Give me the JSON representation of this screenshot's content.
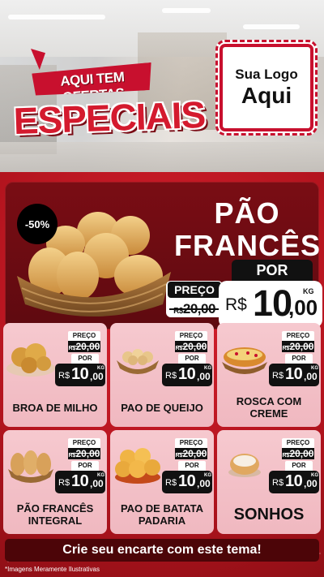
{
  "header": {
    "tag_small": "AQUI TEM OFERTAS",
    "tag_big": "ESPECIAIS",
    "logo_line1": "Sua Logo",
    "logo_line2": "Aqui"
  },
  "featured": {
    "discount": "-50%",
    "title_line1": "PÃO",
    "title_line2": "FRANCÊS",
    "preco_label": "PREÇO",
    "old_currency": "R$",
    "old_price": "20,00",
    "por_label": "POR",
    "new_currency": "R$",
    "new_int": "10",
    "new_dec": ",00",
    "unit": "KG"
  },
  "products": [
    {
      "name": "BROA DE MILHO",
      "preco_label": "PREÇO",
      "old_currency": "R$",
      "old_price": "20,00",
      "por_label": "POR",
      "new_currency": "R$",
      "new_int": "10",
      "new_dec": ",00",
      "unit": "KG",
      "image": "broa-image"
    },
    {
      "name": "PAO DE QUEIJO",
      "preco_label": "PREÇO",
      "old_currency": "R$",
      "old_price": "20,00",
      "por_label": "POR",
      "new_currency": "R$",
      "new_int": "10",
      "new_dec": ",00",
      "unit": "KG",
      "image": "pao-de-queijo-image"
    },
    {
      "name": "ROSCA COM CREME",
      "preco_label": "PREÇO",
      "old_currency": "R$",
      "old_price": "20,00",
      "por_label": "POR",
      "new_currency": "R$",
      "new_int": "10",
      "new_dec": ",00",
      "unit": "KG",
      "image": "rosca-image"
    },
    {
      "name": "PÃO FRANCÊS INTEGRAL",
      "preco_label": "PREÇO",
      "old_currency": "R$",
      "old_price": "20,00",
      "por_label": "POR",
      "new_currency": "R$",
      "new_int": "10",
      "new_dec": ",00",
      "unit": "KG",
      "image": "pao-integral-image"
    },
    {
      "name": "PAO DE BATATA PADARIA",
      "preco_label": "PREÇO",
      "old_currency": "R$",
      "old_price": "20,00",
      "por_label": "POR",
      "new_currency": "R$",
      "new_int": "10",
      "new_dec": ",00",
      "unit": "KG",
      "image": "pao-de-batata-image"
    },
    {
      "name": "SONHOS",
      "preco_label": "PREÇO",
      "old_currency": "R$",
      "old_price": "20,00",
      "por_label": "POR",
      "new_currency": "R$",
      "new_int": "10",
      "new_dec": ",00",
      "unit": "KG",
      "image": "sonho-image"
    }
  ],
  "cta": "Crie seu encarte com este tema!",
  "disclaimer": "*Imagens Meramente Ilustrativas",
  "colors": {
    "brand_red": "#c8102e",
    "dark_red": "#6e0f12",
    "card_pink": "#f6c9cf"
  }
}
